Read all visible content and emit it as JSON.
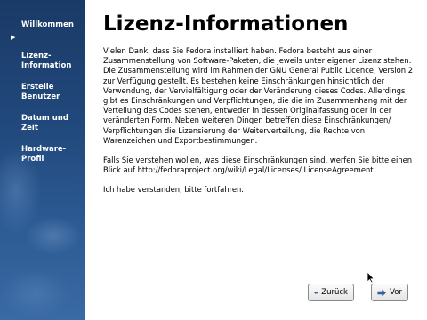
{
  "sidebar": {
    "items": [
      {
        "label": "Willkommen",
        "active": false
      },
      {
        "label": "Lizenz-\nInformation",
        "active": true
      },
      {
        "label": "Erstelle\nBenutzer",
        "active": false
      },
      {
        "label": "Datum und\nZeit",
        "active": false
      },
      {
        "label": "Hardware-\nProfil",
        "active": false
      }
    ]
  },
  "main": {
    "title": "Lizenz-Informationen",
    "paragraphs": [
      "Vielen Dank, dass Sie Fedora installiert haben. Fedora besteht aus einer Zusammenstellung von Software-Paketen, die jeweils unter eigener Lizenz stehen. Die Zusammenstellung wird im Rahmen der GNU General Public Licence, Version 2 zur Verfügung gestellt. Es bestehen keine Einschränkungen hinsichtlich der Verwendung, der Vervielfältigung oder der Veränderung dieses Codes. Allerdings gibt es Einschränkungen und Verpflichtungen, die die im Zusammenhang mit der Verteilung des Codes stehen, entweder in dessen Originalfassung oder in der veränderten Form. Neben weiteren Dingen betreffen diese Einschränkungen/ Verpflichtungen die Lizensierung der Weiterverteilung, die Rechte von Warenzeichen und Exportbestimmungen.",
      "Falls Sie verstehen wollen, was diese Einschränkungen sind, werfen Sie bitte einen Blick auf http://fedoraproject.org/wiki/Legal/Licenses/ LicenseAgreement.",
      "Ich habe verstanden, bitte fortfahren."
    ]
  },
  "buttons": {
    "back_label": "Zurück",
    "next_label": "Vor"
  },
  "colors": {
    "sidebar_top": "#1a3a66",
    "sidebar_bottom": "#3a6aa4",
    "button_icon": "#3465a4"
  }
}
